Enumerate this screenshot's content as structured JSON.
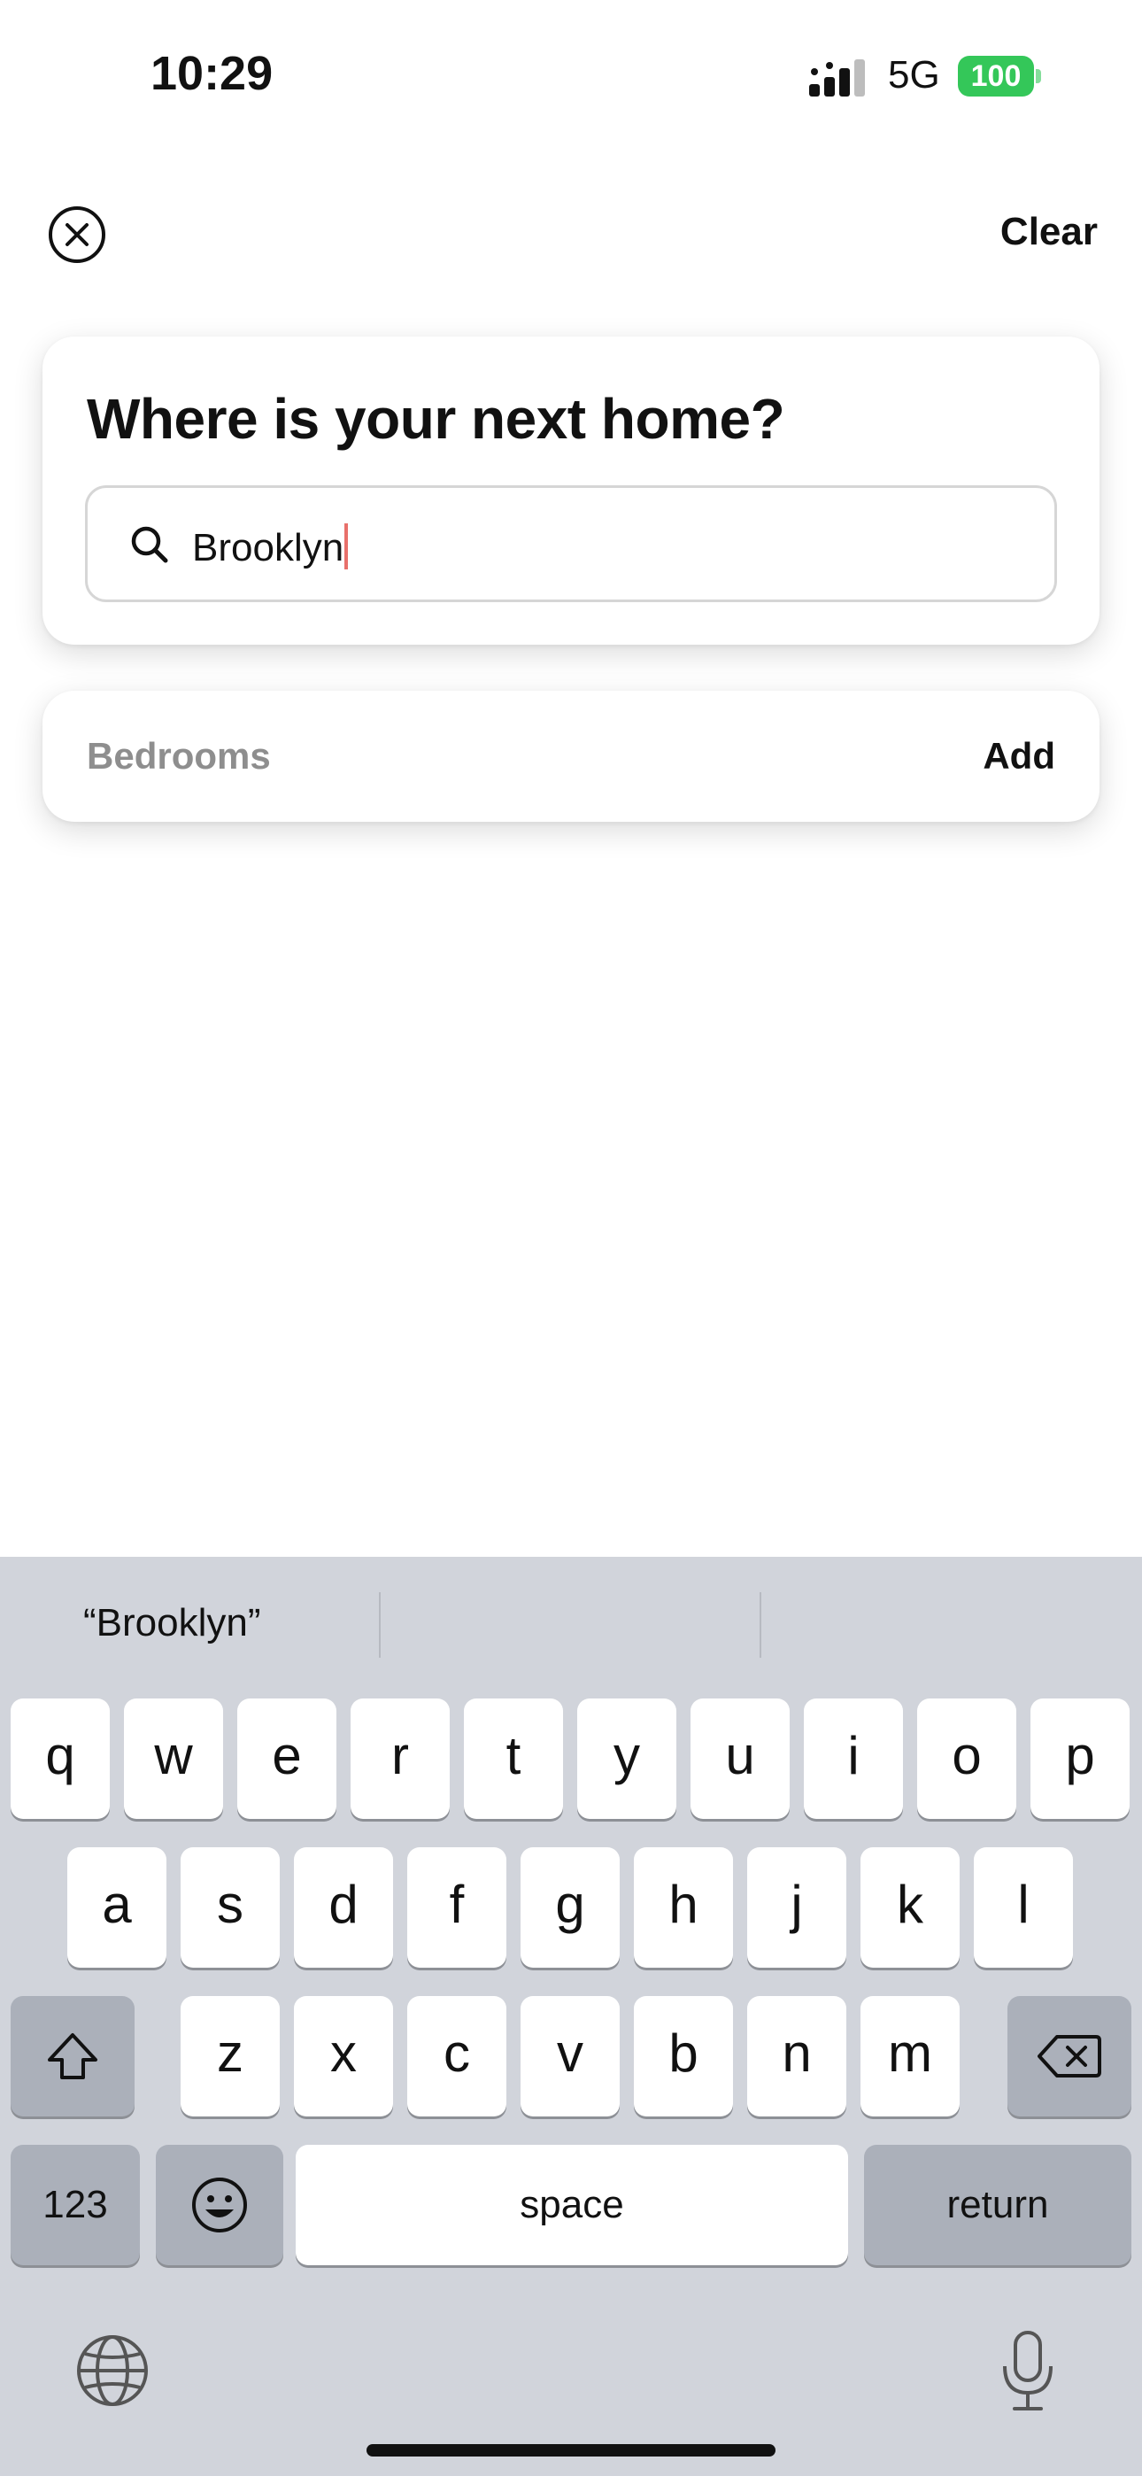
{
  "status_bar": {
    "time": "10:29",
    "network": "5G",
    "battery": "100",
    "signal_icon": "signal-bars-icon",
    "battery_color": "#34c759"
  },
  "header": {
    "close_icon": "close-circle-icon",
    "clear_label": "Clear"
  },
  "search_card": {
    "title": "Where is your next home?",
    "search_icon": "search-icon",
    "search_value": "Brooklyn",
    "caret_color": "#e8706b"
  },
  "bedrooms_card": {
    "label": "Bedrooms",
    "action": "Add"
  },
  "keyboard": {
    "suggestion": "“Brooklyn”",
    "row1": [
      "q",
      "w",
      "e",
      "r",
      "t",
      "y",
      "u",
      "i",
      "o",
      "p"
    ],
    "row2": [
      "a",
      "s",
      "d",
      "f",
      "g",
      "h",
      "j",
      "k",
      "l"
    ],
    "row3": [
      "z",
      "x",
      "c",
      "v",
      "b",
      "n",
      "m"
    ],
    "numbers_key": "123",
    "space_key": "space",
    "return_key": "return",
    "shift_icon": "shift-icon",
    "delete_icon": "delete-backspace-icon",
    "emoji_icon": "emoji-icon",
    "globe_icon": "globe-icon",
    "mic_icon": "microphone-icon"
  }
}
